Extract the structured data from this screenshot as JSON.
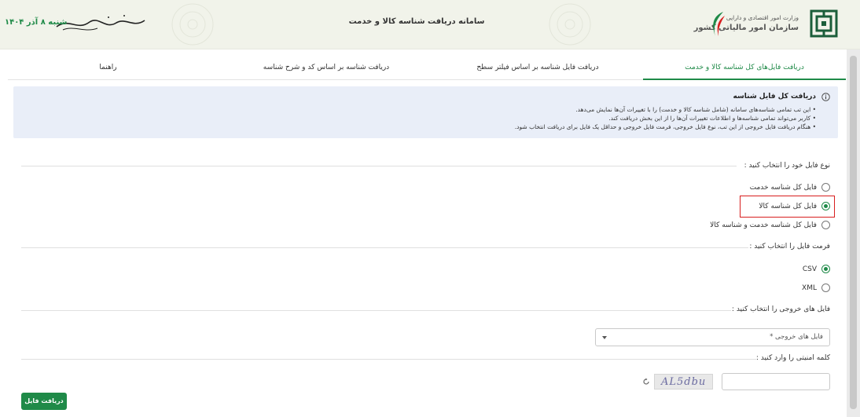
{
  "header": {
    "org_top": "وزارت امور اقتصادی و دارایی",
    "org_main": "سازمان امور مالیاتی کشور",
    "system_title": "سامانه دریافت شناسه کالا و خدمت",
    "date": "شنبه ۸ آذر ۱۴۰۴"
  },
  "tabs": [
    {
      "label": "دریافت فایل‌های کل شناسه کالا و خدمت",
      "active": true
    },
    {
      "label": "دریافت فایل شناسه بر اساس فیلتر سطح",
      "active": false
    },
    {
      "label": "دریافت شناسه بر اساس کد و شرح شناسه",
      "active": false
    },
    {
      "label": "راهنما",
      "active": false
    }
  ],
  "info": {
    "title": "دریافت کل فایل شناسه",
    "items": [
      "این تب تمامی شناسه‌های سامانه (شامل شناسه کالا و خدمت) را با تغییرات آن‌ها نمایش می‌دهد.",
      "کاربر می‌تواند تمامی شناسه‌ها و اطلاعات تغییرات آن‌ها را از این بخش دریافت کند.",
      "هنگام دریافت فایل خروجی از این تب، نوع فایل خروجی، فرمت فایل خروجی و حداقل یک فایل برای دریافت انتخاب شود."
    ]
  },
  "file_type": {
    "label": "نوع فایل خود را انتخاب کنید :",
    "options": [
      {
        "label": "فایل کل شناسه خدمت",
        "checked": false
      },
      {
        "label": "فایل کل شناسه کالا",
        "checked": true
      },
      {
        "label": "فایل کل شناسه خدمت و شناسه کالا",
        "checked": false
      }
    ]
  },
  "file_format": {
    "label": "فرمت فایل را انتخاب کنید :",
    "options": [
      {
        "label": "CSV",
        "checked": true
      },
      {
        "label": "XML",
        "checked": false
      }
    ]
  },
  "output_files": {
    "label": "فایل های خروجی را انتخاب کنید :",
    "placeholder": "فایل های خروجی *"
  },
  "captcha": {
    "label": "کلمه امنیتی را وارد کنید :",
    "image_text": "AL5dbu",
    "value": ""
  },
  "submit_label": "دریافت فایل",
  "colors": {
    "accent": "#1f8a48",
    "highlight": "#d81e1e",
    "info_bg": "#e9eef8"
  }
}
